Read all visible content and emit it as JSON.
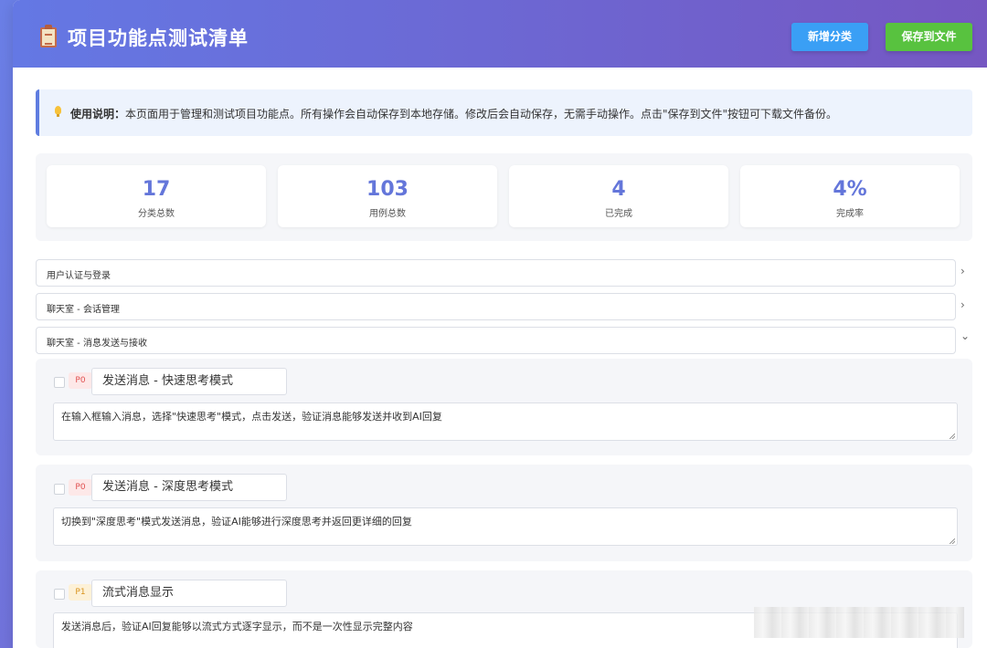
{
  "header": {
    "icon": "clipboard-icon",
    "title": "项目功能点测试清单",
    "add_category_label": "新增分类",
    "save_to_file_label": "保存到文件"
  },
  "notice": {
    "icon": "lightbulb-icon",
    "label": "使用说明：",
    "text": "本页面用于管理和测试项目功能点。所有操作会自动保存到本地存储。修改后会自动保存，无需手动操作。点击\"保存到文件\"按钮可下载文件备份。"
  },
  "stats": [
    {
      "value": "17",
      "label": "分类总数"
    },
    {
      "value": "103",
      "label": "用例总数"
    },
    {
      "value": "4",
      "label": "已完成"
    },
    {
      "value": "4%",
      "label": "完成率"
    }
  ],
  "categories": [
    {
      "label": "用户认证与登录",
      "chevron": "›",
      "expanded": false
    },
    {
      "label": "聊天室 - 会话管理",
      "chevron": "›",
      "expanded": false
    },
    {
      "label": "聊天室 - 消息发送与接收",
      "chevron": "⌄",
      "expanded": true
    }
  ],
  "cases": [
    {
      "priority": "P0",
      "title": "发送消息 - 快速思考模式",
      "description": "在输入框输入消息，选择\"快速思考\"模式，点击发送，验证消息能够发送并收到AI回复",
      "checked": false
    },
    {
      "priority": "P0",
      "title": "发送消息 - 深度思考模式",
      "description": "切换到\"深度思考\"模式发送消息，验证AI能够进行深度思考并返回更详细的回复",
      "checked": false
    },
    {
      "priority": "P1",
      "title": "流式消息显示",
      "description": "发送消息后，验证AI回复能够以流式方式逐字显示，而不是一次性显示完整内容",
      "checked": false
    }
  ],
  "colors": {
    "accent": "#6476da",
    "add_button": "#3a9ff5",
    "save_button": "#58c23f",
    "p0": "#e05050",
    "p1": "#d9931d"
  }
}
